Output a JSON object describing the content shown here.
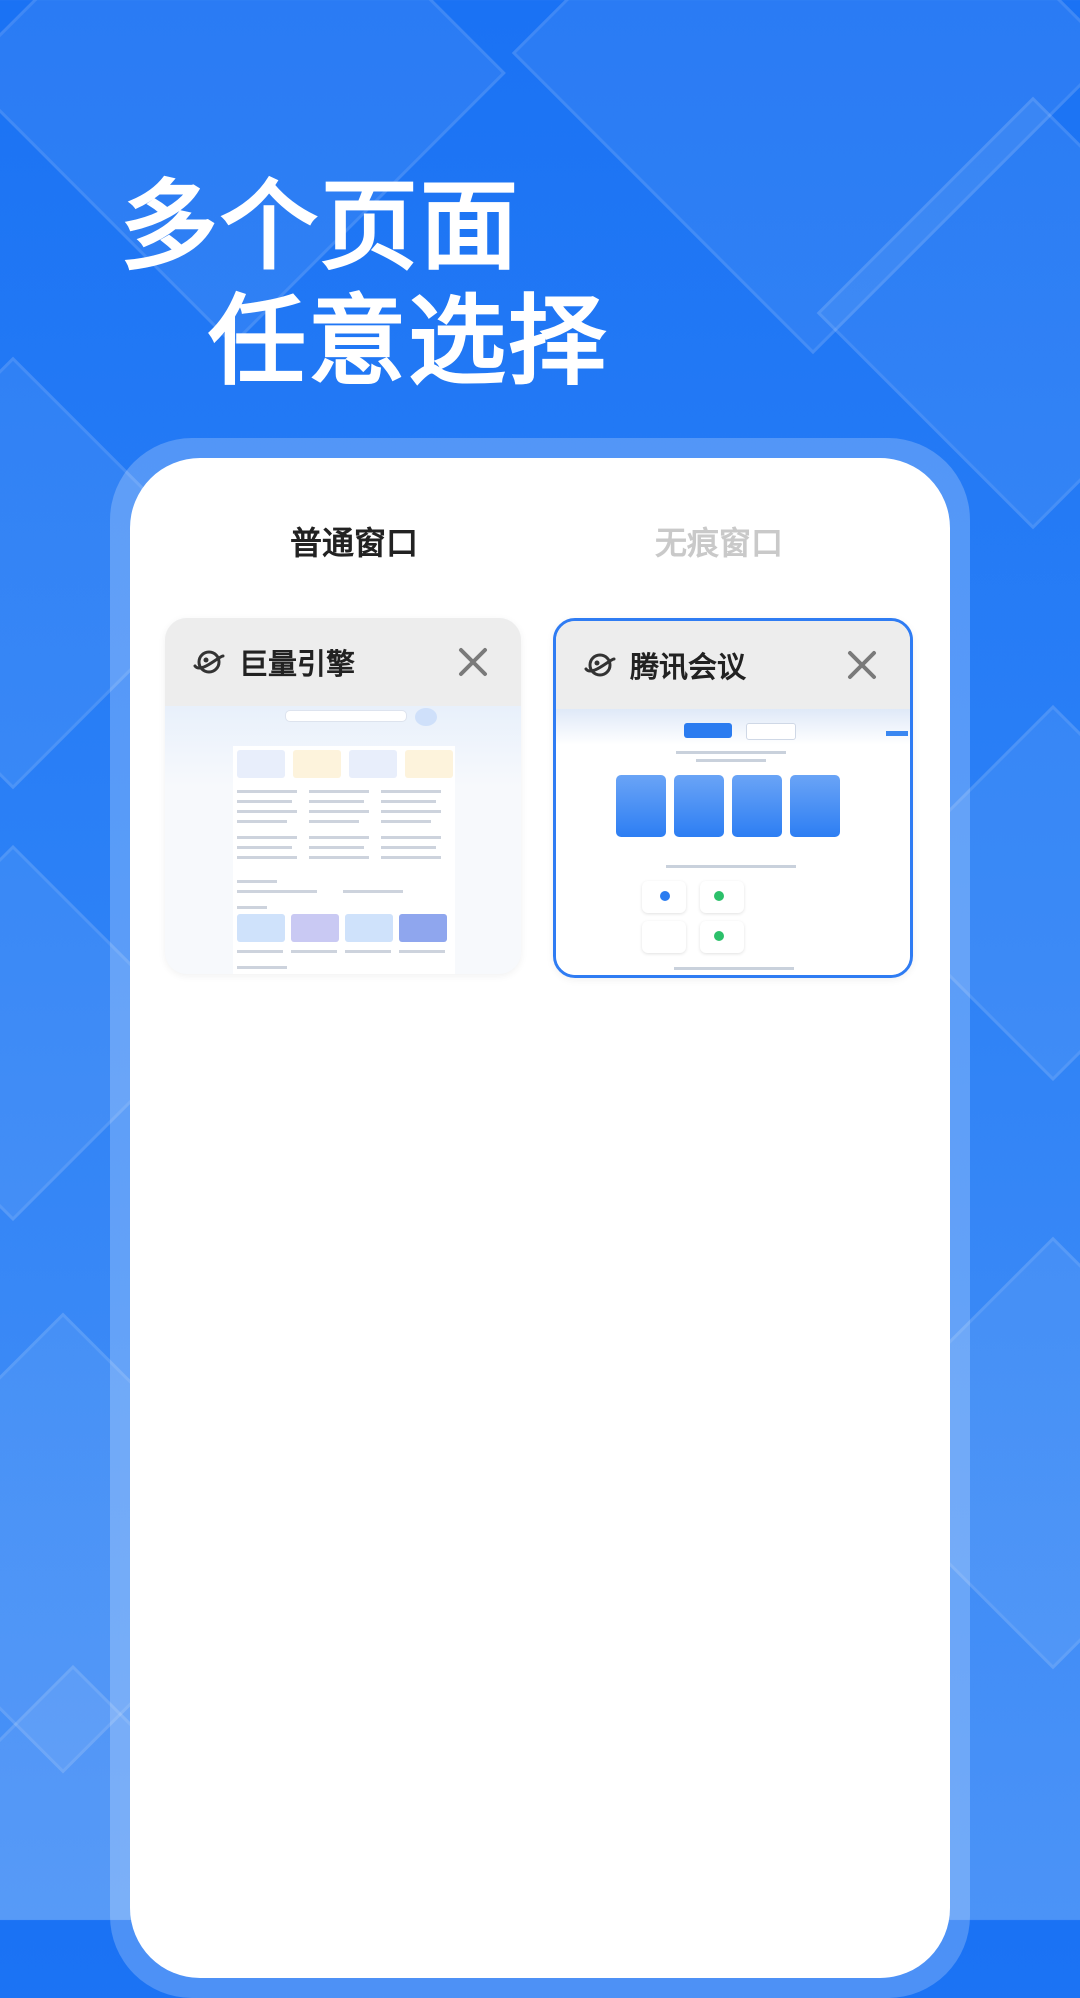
{
  "headline": {
    "line1": "多个页面",
    "line2": "任意选择"
  },
  "tabs": {
    "normal": "普通窗口",
    "private": "无痕窗口",
    "active": "normal"
  },
  "cards": [
    {
      "title": "巨量引擎",
      "icon": "planet-icon",
      "close_icon": "close-icon",
      "selected": false
    },
    {
      "title": "腾讯会议",
      "icon": "planet-icon",
      "close_icon": "close-icon",
      "selected": true
    }
  ],
  "colors": {
    "background": "#1a72f4",
    "accent": "#1a6ff4",
    "tab_inactive": "#c9c9c9"
  }
}
